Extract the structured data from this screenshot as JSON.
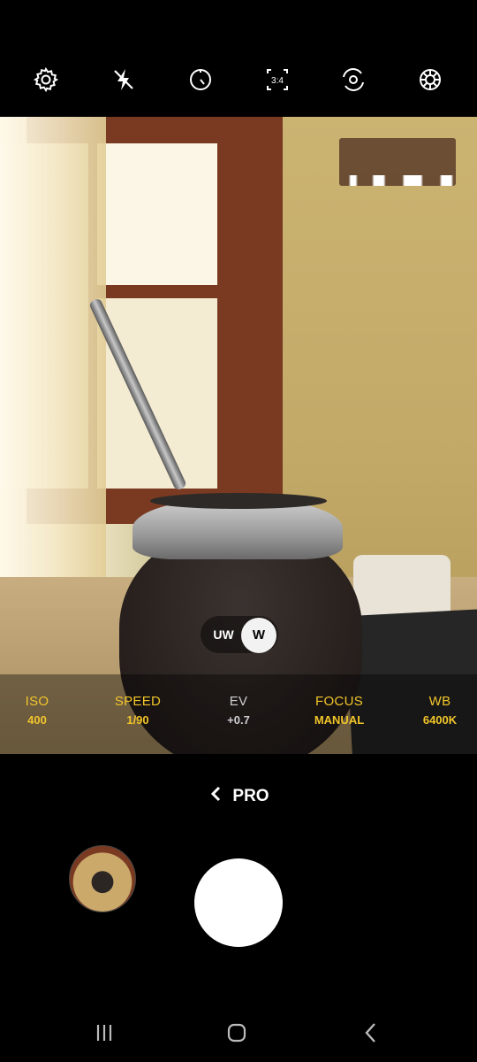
{
  "topbar": {
    "icons": [
      "gear-icon",
      "flash-off-icon",
      "timer-icon",
      "aspect-ratio-icon",
      "motion-photo-icon",
      "filter-icon"
    ],
    "aspect_ratio_label": "3:4"
  },
  "viewfinder": {
    "lens": {
      "uw_label": "UW",
      "w_label": "W",
      "selected": "W"
    },
    "pro_settings": [
      {
        "label": "ISO",
        "value": "400"
      },
      {
        "label": "SPEED",
        "value": "1/90"
      },
      {
        "label": "EV",
        "value": "+0.7"
      },
      {
        "label": "FOCUS",
        "value": "MANUAL"
      },
      {
        "label": "WB",
        "value": "6400K"
      }
    ]
  },
  "mode": {
    "label": "PRO"
  },
  "colors": {
    "accent": "#f2c52a",
    "background": "#000000"
  },
  "navbar": {
    "icons": [
      "recents-icon",
      "home-icon",
      "back-icon"
    ]
  }
}
